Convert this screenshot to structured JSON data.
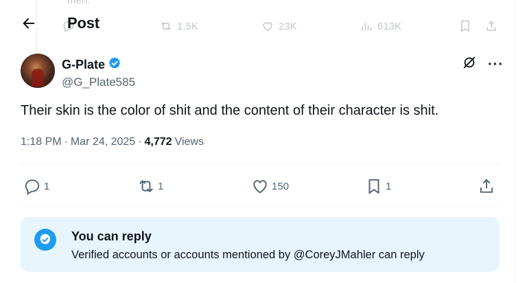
{
  "ghost_tweet": {
    "text": "men.",
    "reply_count": "",
    "repost_count": "1.5K",
    "like_count": "23K",
    "view_count": "613K"
  },
  "header": {
    "title": "Post",
    "back_icon": "arrow-left-icon"
  },
  "tweet": {
    "author": {
      "display_name": "G-Plate",
      "handle": "@G_Plate585",
      "verified": true
    },
    "text": "Their skin is the color of shit and the content of their character is shit.",
    "time": "1:18 PM",
    "date": "Mar 24, 2025",
    "separator": "·",
    "views_count": "4,772",
    "views_label": "Views",
    "actions": {
      "replies": "1",
      "reposts": "1",
      "likes": "150",
      "bookmarks": "1"
    }
  },
  "reply_notice": {
    "title": "You can reply",
    "subtitle": "Verified accounts or accounts mentioned by @CoreyJMahler can reply"
  },
  "colors": {
    "accent": "#1d9bf0",
    "text_primary": "#0f1419",
    "text_secondary": "#536471",
    "reply_box_bg": "#e8f5fd"
  }
}
